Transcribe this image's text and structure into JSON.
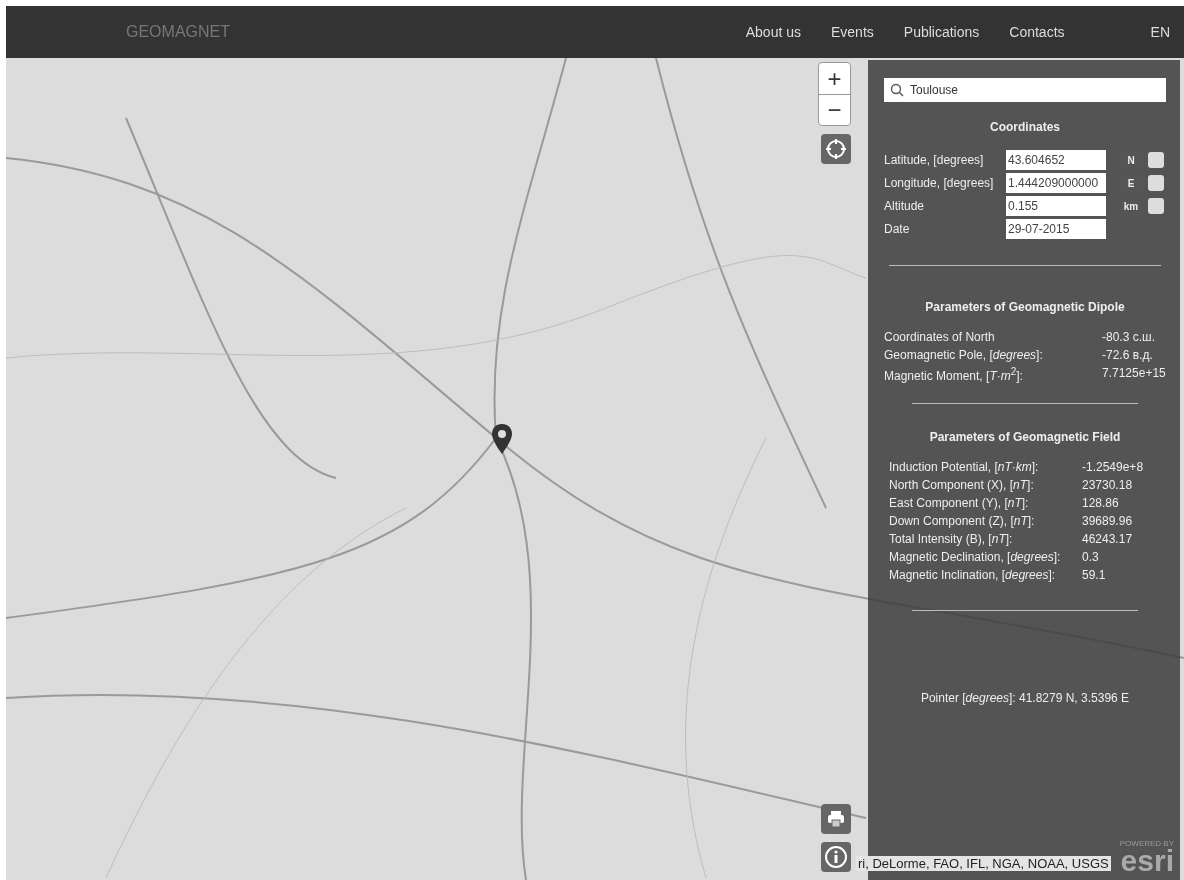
{
  "navbar": {
    "brand": "GEOMAGNET",
    "links": [
      "About us",
      "Events",
      "Publications",
      "Contacts"
    ],
    "language": "EN"
  },
  "map_controls": {
    "zoom_in": "+",
    "zoom_out": "−"
  },
  "panel": {
    "search": {
      "value": "Toulouse"
    },
    "coordinates": {
      "title": "Coordinates",
      "rows": [
        {
          "label": "Latitude, [degrees]",
          "value": "43.604652",
          "unit": "N",
          "checked": false
        },
        {
          "label": "Longitude, [degrees]",
          "value": "1.444209000000",
          "unit": "E",
          "checked": false
        },
        {
          "label": "Altitude",
          "value": "0.155",
          "unit": "km",
          "checked": false
        },
        {
          "label": "Date",
          "value": "29-07-2015"
        }
      ]
    },
    "dipole": {
      "title": "Parameters of Geomagnetic Dipole",
      "rows": [
        {
          "label": "Coordinates of North",
          "value": "-80.3 с.ш."
        },
        {
          "label": "Geomagnetic Pole, [*degrees*]:",
          "value": "-72.6 в.д."
        },
        {
          "label": "Magnetic Moment, [*T·m*$^{2}$]:",
          "value": "7.7125e+15"
        }
      ]
    },
    "field": {
      "title": "Parameters of Geomagnetic Field",
      "rows": [
        {
          "label": "Induction Potential, [*nT·km*]:",
          "value": "-1.2549e+8"
        },
        {
          "label": "North Component (X), [*nT*]:",
          "value": "23730.18"
        },
        {
          "label": "East Component (Y), [*nT*]:",
          "value": "128.86"
        },
        {
          "label": "Down Component (Z), [*nT*]:",
          "value": "39689.96"
        },
        {
          "label": "Total Intensity (B), [*nT*]:",
          "value": "46243.17"
        },
        {
          "label": "Magnetic Declination, [*degrees*]:",
          "value": "0.3"
        },
        {
          "label": "Magnetic Inclination, [*degrees*]:",
          "value": "59.1"
        }
      ]
    },
    "pointer": "Pointer [*degrees*]: 41.8279 N, 3.5396 E"
  },
  "attribution": "ri, DeLorme, FAO, IFL, NGA, NOAA, USGS",
  "esri_logo": {
    "caption": "POWERED BY",
    "name": "esri"
  }
}
